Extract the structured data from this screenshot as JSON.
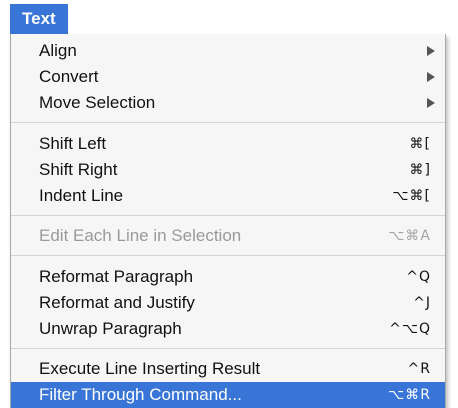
{
  "menu_title": "Text",
  "groups": {
    "arrange": [
      {
        "label": "Align",
        "submenu": true
      },
      {
        "label": "Convert",
        "submenu": true
      },
      {
        "label": "Move Selection",
        "submenu": true
      }
    ],
    "shift": [
      {
        "label": "Shift Left",
        "shortcut": "⌘["
      },
      {
        "label": "Shift Right",
        "shortcut": "⌘]"
      },
      {
        "label": "Indent Line",
        "shortcut": "⌥⌘["
      }
    ],
    "edit": [
      {
        "label": "Edit Each Line in Selection",
        "shortcut": "⌥⌘A",
        "disabled": true
      }
    ],
    "reformat": [
      {
        "label": "Reformat Paragraph",
        "shortcut": "^Q"
      },
      {
        "label": "Reformat and Justify",
        "shortcut": "^J"
      },
      {
        "label": "Unwrap Paragraph",
        "shortcut": "^⌥Q"
      }
    ],
    "execute": [
      {
        "label": "Execute Line Inserting Result",
        "shortcut": "^R"
      },
      {
        "label": "Filter Through Command...",
        "shortcut": "⌥⌘R",
        "selected": true
      }
    ]
  },
  "colors": {
    "highlight": "#3875d7",
    "menu_background": "#f6f6f6",
    "disabled_text": "#9a9a9a"
  }
}
